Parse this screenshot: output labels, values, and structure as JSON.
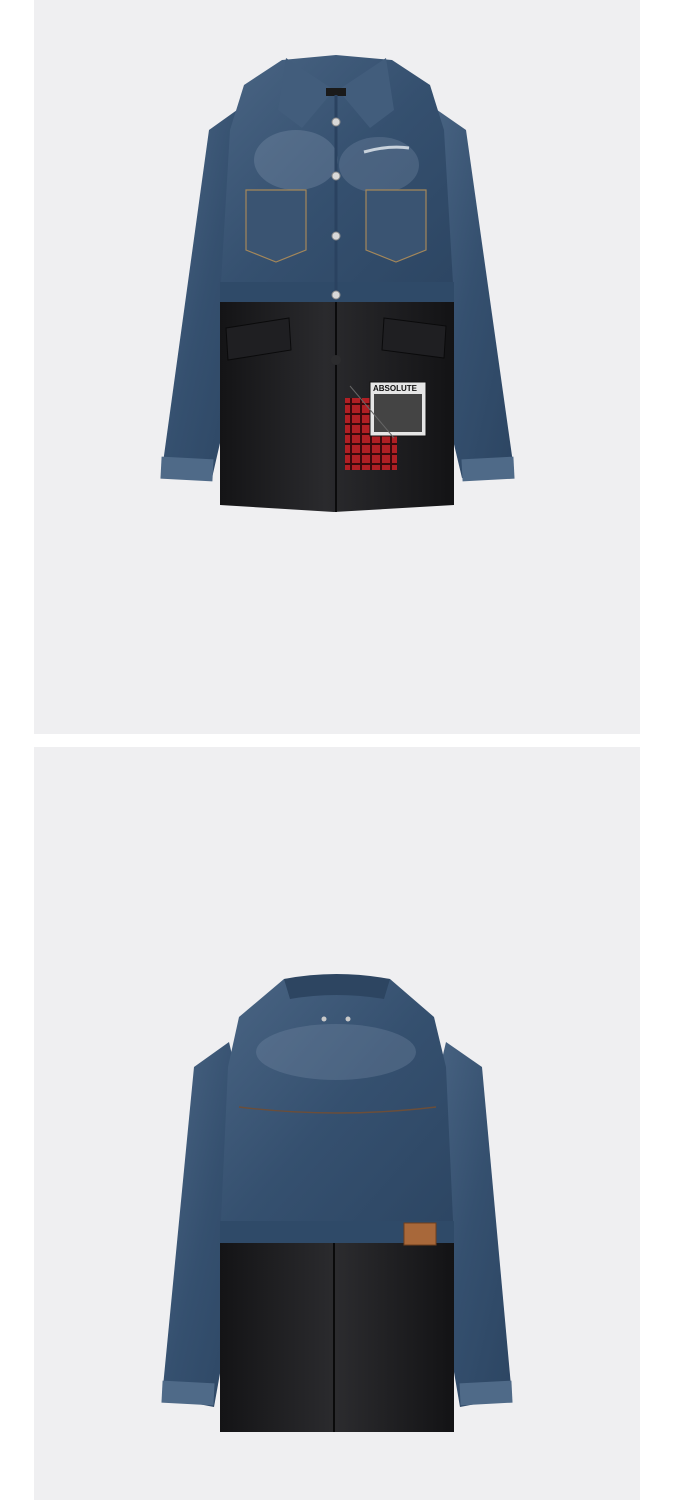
{
  "gallery": {
    "images": [
      {
        "view": "front",
        "patch_text": "ABSOLUTE"
      },
      {
        "view": "back"
      }
    ]
  },
  "colors": {
    "background": "#efeff1",
    "denim": "#3d5573",
    "denim_light": "#7d93ab",
    "leather": "#1b1b1d",
    "plaid_red": "#b01f24",
    "label_tan": "#a8683a"
  }
}
